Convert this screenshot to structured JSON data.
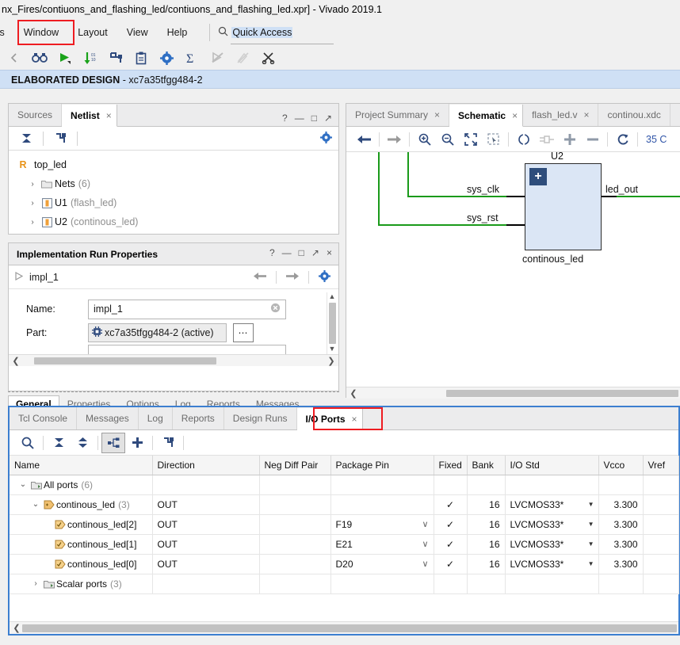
{
  "window": {
    "title": "nx_Fires/contiuons_and_flashing_led/contiuons_and_flashing_led.xpr] - Vivado 2019.1"
  },
  "menubar": {
    "items": [
      {
        "label": "ts"
      },
      {
        "label": "Window"
      },
      {
        "label": "Layout"
      },
      {
        "label": "View"
      },
      {
        "label": "Help"
      }
    ],
    "highlight_color": "#ee1c21"
  },
  "quick_access": {
    "value": "Quick Access",
    "icon": "search-icon"
  },
  "toolbar": {
    "buttons": [
      {
        "name": "back-arrow-icon",
        "label": ""
      },
      {
        "name": "binoculars-icon",
        "label": ""
      },
      {
        "name": "run-play-icon",
        "label": ""
      },
      {
        "name": "download-bitstream-icon",
        "label": ""
      },
      {
        "name": "flow-navigator-icon",
        "label": ""
      },
      {
        "name": "clipboard-report-icon",
        "label": ""
      },
      {
        "name": "settings-gear-icon",
        "label": ""
      },
      {
        "name": "sigma-icon",
        "label": ""
      },
      {
        "name": "cancel-run-icon",
        "label": ""
      },
      {
        "name": "no-edit-icon",
        "label": ""
      },
      {
        "name": "scissors-icon",
        "label": ""
      }
    ]
  },
  "banner": {
    "title": "ELABORATED DESIGN",
    "subtitle": " - xc7a35tfgg484-2"
  },
  "netlist_panel": {
    "tabs": [
      {
        "label": "Sources",
        "active": false
      },
      {
        "label": "Netlist",
        "active": true,
        "close": "×"
      }
    ],
    "controls": [
      "?",
      "—",
      "□",
      "↗"
    ],
    "tree": {
      "root": {
        "badge": "R",
        "label": "top_led"
      },
      "nodes": [
        {
          "arrow": "›",
          "icon": "folder-icon",
          "label": "Nets",
          "count": "(6)"
        },
        {
          "arrow": "›",
          "icon": "module-icon",
          "label": "U1",
          "count": "(flash_led)"
        },
        {
          "arrow": "›",
          "icon": "module-icon",
          "label": "U2",
          "count": "(continous_led)"
        }
      ]
    }
  },
  "implementation_panel": {
    "title": "Implementation Run Properties",
    "controls": [
      "?",
      "—",
      "□",
      "↗",
      "×"
    ],
    "run_name": "impl_1",
    "form": {
      "name_label": "Name:",
      "name_value": "impl_1",
      "part_label": "Part:",
      "part_value": "xc7a35tfgg484-2 (active)",
      "browse_label": "⋯"
    },
    "tabs": [
      {
        "label": "General",
        "active": true
      },
      {
        "label": "Properties",
        "active": false
      },
      {
        "label": "Options",
        "active": false
      },
      {
        "label": "Log",
        "active": false
      },
      {
        "label": "Reports",
        "active": false
      },
      {
        "label": "Messages",
        "active": false
      }
    ]
  },
  "schematic_panel": {
    "tabs": [
      {
        "label": "Project Summary",
        "active": false,
        "close": "×"
      },
      {
        "label": "Schematic",
        "active": true,
        "close": "×"
      },
      {
        "label": "flash_led.v",
        "active": false,
        "close": "×"
      },
      {
        "label": "continou.xdc",
        "active": false
      }
    ],
    "toolbar": [
      {
        "name": "nav-back-icon"
      },
      {
        "name": "nav-forward-icon"
      },
      {
        "name": "zoom-in-icon"
      },
      {
        "name": "zoom-out-icon"
      },
      {
        "name": "zoom-fit-icon"
      },
      {
        "name": "zoom-area-icon"
      },
      {
        "name": "center-view-icon"
      },
      {
        "name": "expand-cell-icon"
      },
      {
        "name": "add-cell-icon"
      },
      {
        "name": "remove-cell-icon"
      },
      {
        "name": "regenerate-icon"
      }
    ],
    "zoom_status": "35 C",
    "diagram": {
      "instance_label": "U2",
      "block_name": "continous_led",
      "expand_glyph": "+",
      "inputs": [
        "sys_clk",
        "sys_rst"
      ],
      "outputs": [
        "led_out"
      ],
      "wire_color": "#1a9a1a",
      "block_fill": "#dbe6f5"
    }
  },
  "bottom_dock": {
    "tabs": [
      {
        "label": "Tcl Console",
        "active": false
      },
      {
        "label": "Messages",
        "active": false
      },
      {
        "label": "Log",
        "active": false
      },
      {
        "label": "Reports",
        "active": false
      },
      {
        "label": "Design Runs",
        "active": false
      },
      {
        "label": "I/O Ports",
        "active": true,
        "close": "×"
      }
    ],
    "highlight_color": "#ee1c21",
    "toolbar": [
      {
        "name": "search-icon"
      },
      {
        "name": "collapse-all-icon"
      },
      {
        "name": "expand-all-icon"
      },
      {
        "name": "hierarchy-icon",
        "selected": true
      },
      {
        "name": "add-port-icon"
      },
      {
        "name": "auto-fit-icon"
      }
    ],
    "table": {
      "columns": [
        "Name",
        "Direction",
        "Neg Diff Pair",
        "Package Pin",
        "Fixed",
        "Bank",
        "I/O Std",
        "Vcco",
        "Vref"
      ],
      "rows": [
        {
          "indent": 0,
          "arrow": "⌄",
          "icon": "ports-group-icon",
          "name": "All ports",
          "count": "(6)",
          "direction": "",
          "neg_diff_pair": "",
          "package_pin": "",
          "fixed": "",
          "bank": "",
          "io_std": "",
          "vcco": "",
          "vref": ""
        },
        {
          "indent": 1,
          "arrow": "⌄",
          "icon": "bus-port-icon",
          "name": "continous_led",
          "count": "(3)",
          "direction": "OUT",
          "neg_diff_pair": "",
          "package_pin": "",
          "fixed": "✓",
          "bank": "16",
          "io_std": "LVCMOS33*",
          "vcco": "3.300",
          "vref": ""
        },
        {
          "indent": 2,
          "arrow": "",
          "icon": "port-icon",
          "name": "continous_led[2]",
          "count": "",
          "direction": "OUT",
          "neg_diff_pair": "",
          "package_pin": "F19",
          "fixed": "✓",
          "bank": "16",
          "io_std": "LVCMOS33*",
          "vcco": "3.300",
          "vref": ""
        },
        {
          "indent": 2,
          "arrow": "",
          "icon": "port-icon",
          "name": "continous_led[1]",
          "count": "",
          "direction": "OUT",
          "neg_diff_pair": "",
          "package_pin": "E21",
          "fixed": "✓",
          "bank": "16",
          "io_std": "LVCMOS33*",
          "vcco": "3.300",
          "vref": ""
        },
        {
          "indent": 2,
          "arrow": "",
          "icon": "port-icon",
          "name": "continous_led[0]",
          "count": "",
          "direction": "OUT",
          "neg_diff_pair": "",
          "package_pin": "D20",
          "fixed": "✓",
          "bank": "16",
          "io_std": "LVCMOS33*",
          "vcco": "3.300",
          "vref": ""
        },
        {
          "indent": 0,
          "arrow": "›",
          "icon": "ports-group-icon",
          "name": "Scalar ports",
          "count": "(3)",
          "direction": "",
          "neg_diff_pair": "",
          "package_pin": "",
          "fixed": "",
          "bank": "",
          "io_std": "",
          "vcco": "",
          "vref": ""
        }
      ]
    }
  }
}
